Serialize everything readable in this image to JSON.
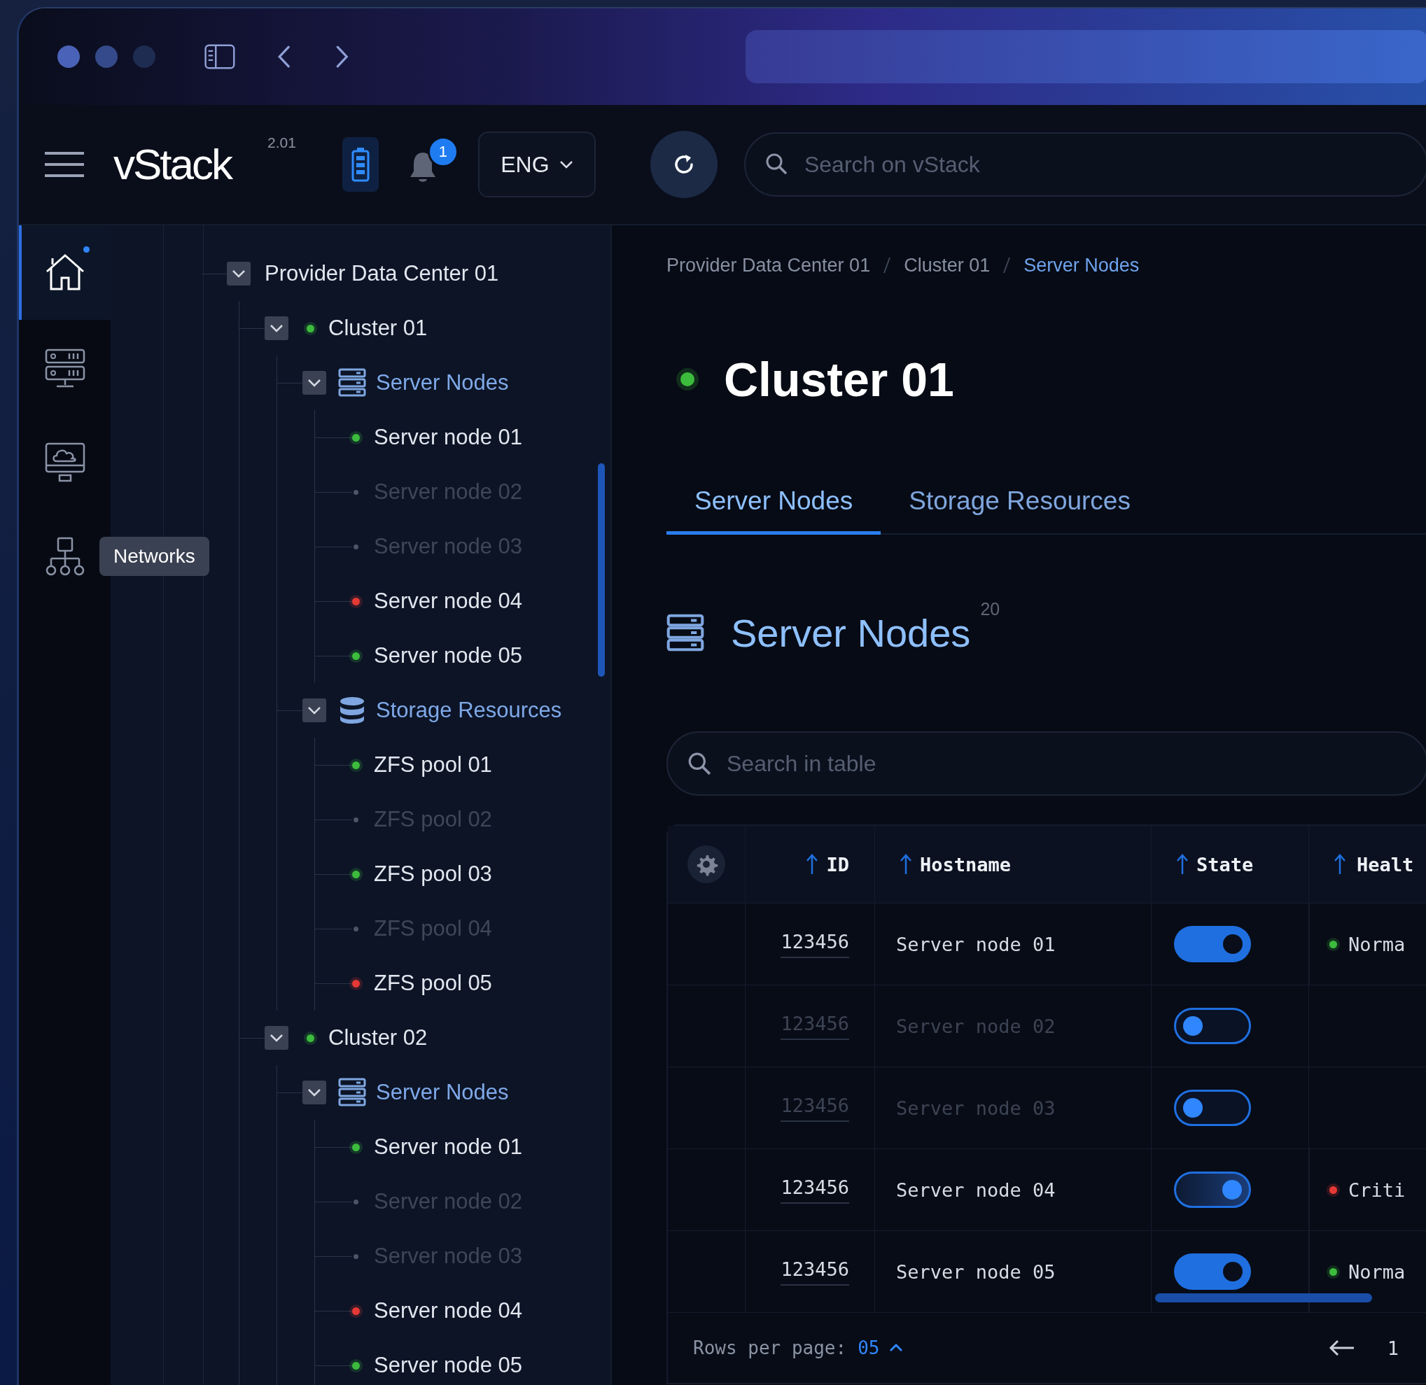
{
  "header": {
    "logo": "vStack",
    "version": "2.01",
    "notifications": "1",
    "language": "ENG",
    "search": {
      "placeholder": "Search on vStack"
    }
  },
  "rail": [
    {
      "kind": "home",
      "selected": true,
      "notified": true
    },
    {
      "kind": "servers",
      "selected": false,
      "notified": false
    },
    {
      "kind": "cloud",
      "selected": false,
      "notified": false
    },
    {
      "kind": "network",
      "selected": false,
      "notified": false,
      "tooltip": "Networks"
    }
  ],
  "tree": [
    {
      "label": "Provider Data Center 01",
      "expanded": true,
      "children": [
        {
          "label": "Cluster 01",
          "color": "#3dbb3d",
          "expanded": true,
          "children": [
            {
              "kind": "servers",
              "label": "Server Nodes",
              "expanded": true,
              "children": [
                {
                  "label": "Server node 01",
                  "color": "#3dbb3d",
                  "disabled": false
                },
                {
                  "label": "Server node 02",
                  "color": "#4c5566",
                  "disabled": true
                },
                {
                  "label": "Server node 03",
                  "color": "#4c5566",
                  "disabled": true
                },
                {
                  "label": "Server node 04",
                  "color": "#e53935",
                  "disabled": false
                },
                {
                  "label": "Server node 05",
                  "color": "#3dbb3d",
                  "disabled": false
                }
              ]
            },
            {
              "kind": "storage",
              "label": "Storage Resources",
              "expanded": true,
              "children": [
                {
                  "label": "ZFS pool 01",
                  "color": "#3dbb3d",
                  "disabled": false
                },
                {
                  "label": "ZFS pool 02",
                  "color": "#4c5566",
                  "disabled": true
                },
                {
                  "label": "ZFS pool 03",
                  "color": "#3dbb3d",
                  "disabled": false
                },
                {
                  "label": "ZFS pool 04",
                  "color": "#4c5566",
                  "disabled": true
                },
                {
                  "label": "ZFS pool 05",
                  "color": "#e53935",
                  "disabled": false
                }
              ]
            }
          ]
        },
        {
          "label": "Cluster 02",
          "color": "#3dbb3d",
          "expanded": true,
          "children": [
            {
              "kind": "servers",
              "label": "Server Nodes",
              "expanded": true,
              "children": [
                {
                  "label": "Server node 01",
                  "color": "#3dbb3d",
                  "disabled": false
                },
                {
                  "label": "Server node 02",
                  "color": "#4c5566",
                  "disabled": true
                },
                {
                  "label": "Server node 03",
                  "color": "#4c5566",
                  "disabled": true
                },
                {
                  "label": "Server node 04",
                  "color": "#e53935",
                  "disabled": false
                },
                {
                  "label": "Server node 05",
                  "color": "#3dbb3d",
                  "disabled": false
                }
              ]
            }
          ]
        }
      ]
    }
  ],
  "breadcrumb": [
    {
      "label": "Provider Data Center 01",
      "current": false
    },
    {
      "label": "Cluster 01",
      "current": false
    },
    {
      "label": "Server Nodes",
      "current": true
    }
  ],
  "page": {
    "title": "Cluster 01",
    "color": "#3dbb3d"
  },
  "tabs": [
    {
      "label": "Server Nodes",
      "selected": true
    },
    {
      "label": "Storage Resources",
      "selected": false
    }
  ],
  "section": {
    "title": "Server Nodes",
    "count": "20"
  },
  "table": {
    "search": {
      "placeholder": "Search in table"
    },
    "columns": [
      "ID",
      "Hostname",
      "State",
      "Healt"
    ],
    "rows": [
      {
        "id": "123456",
        "hostname": "Server node 01",
        "on": true,
        "pending": false,
        "disabled": false,
        "health": {
          "label": "Norma",
          "color": "#3dbb3d"
        }
      },
      {
        "id": "123456",
        "hostname": "Server node 02",
        "on": false,
        "pending": false,
        "disabled": true
      },
      {
        "id": "123456",
        "hostname": "Server node 03",
        "on": false,
        "pending": false,
        "disabled": true
      },
      {
        "id": "123456",
        "hostname": "Server node 04",
        "on": true,
        "pending": true,
        "disabled": false,
        "health": {
          "label": "Criti",
          "color": "#e53935"
        }
      },
      {
        "id": "123456",
        "hostname": "Server node 05",
        "on": true,
        "pending": false,
        "disabled": false,
        "health": {
          "label": "Norma",
          "color": "#3dbb3d"
        }
      }
    ]
  },
  "pagination": {
    "rows_label": "Rows per page:",
    "rows_value": "05",
    "page": "1"
  }
}
